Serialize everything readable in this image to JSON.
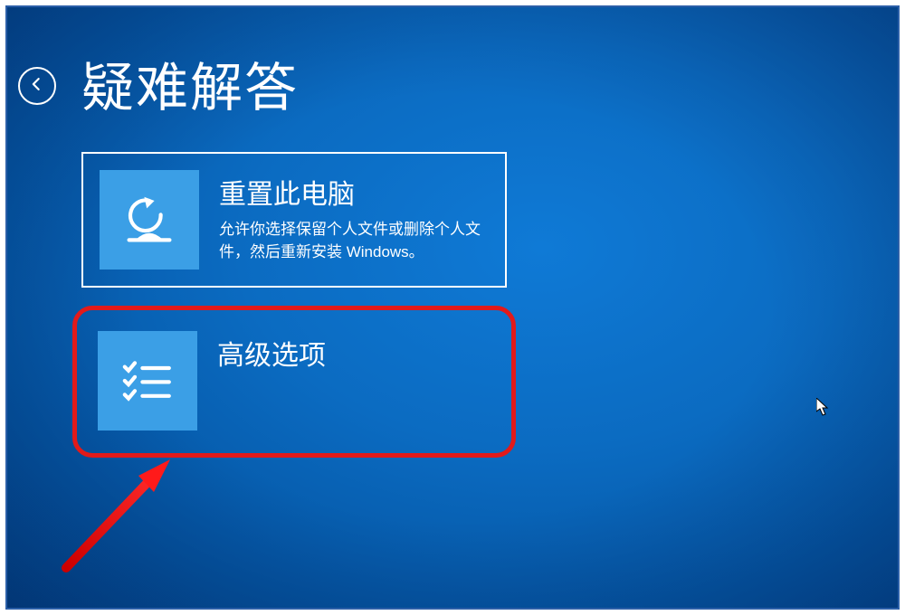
{
  "page_title": "疑难解答",
  "options": {
    "reset": {
      "title": "重置此电脑",
      "description": "允许你选择保留个人文件或删除个人文件，然后重新安装 Windows。",
      "icon": "reset-pc-icon"
    },
    "advanced": {
      "title": "高级选项",
      "icon": "advanced-options-icon"
    }
  },
  "annotation": {
    "highlight_target": "advanced",
    "highlight_color": "#e21a1a"
  }
}
